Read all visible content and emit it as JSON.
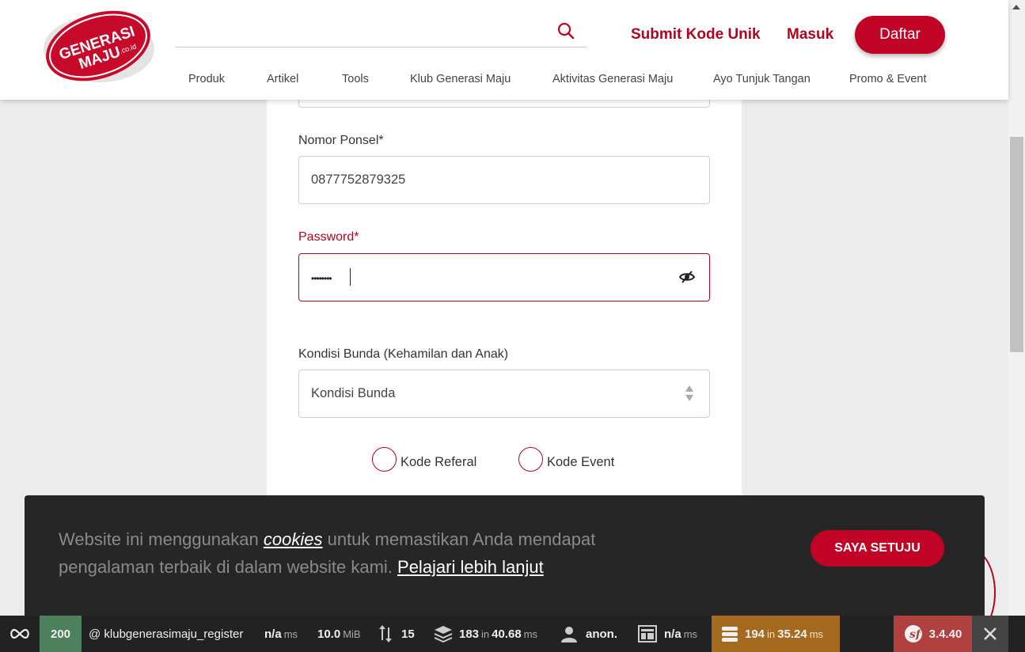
{
  "header": {
    "logo_text": "GENERASI MAJU .co.id",
    "submit_link": "Submit Kode Unik",
    "login_link": "Masuk",
    "register_button": "Daftar",
    "nav": [
      "Produk",
      "Artikel",
      "Tools",
      "Klub Generasi Maju",
      "Aktivitas Generasi Maju",
      "Ayo Tunjuk Tangan",
      "Promo & Event"
    ]
  },
  "form": {
    "phone": {
      "label": "Nomor Ponsel*",
      "value": "0877752879325"
    },
    "password": {
      "label": "Password*",
      "value": "••••••••"
    },
    "condition": {
      "label": "Kondisi Bunda (Kehamilan dan Anak)",
      "placeholder": "Kondisi Bunda"
    },
    "options": [
      "Kode Referal",
      "Kode Event"
    ]
  },
  "cookie": {
    "text_1": "Website ini menggunakan ",
    "link_cookies": "cookies",
    "text_2": " untuk memastikan Anda mendapat pengalaman terbaik di dalam website kami. ",
    "link_more": "Pelajari lebih lanjut",
    "agree_button": "SAYA SETUJU"
  },
  "toolbar": {
    "status": "200",
    "route": "@ klubgenerasimaju_register",
    "time_value": "n/a",
    "time_unit": "ms",
    "memory_value": "10.0",
    "memory_unit": "MiB",
    "requests": "15",
    "cache_value": "183",
    "cache_in": "in",
    "cache_time": "40.68",
    "cache_unit": "ms",
    "user": "anon.",
    "twig_value": "n/a",
    "twig_unit": "ms",
    "db_value": "194",
    "db_in": "in",
    "db_time": "35.24",
    "db_unit": "ms",
    "version": "3.4.40"
  },
  "colors": {
    "brand": "#c10325",
    "accent_text": "#b3041f",
    "db_panel": "#a46a1f",
    "status_ok": "#4f805d",
    "version_panel": "#b0413e"
  }
}
